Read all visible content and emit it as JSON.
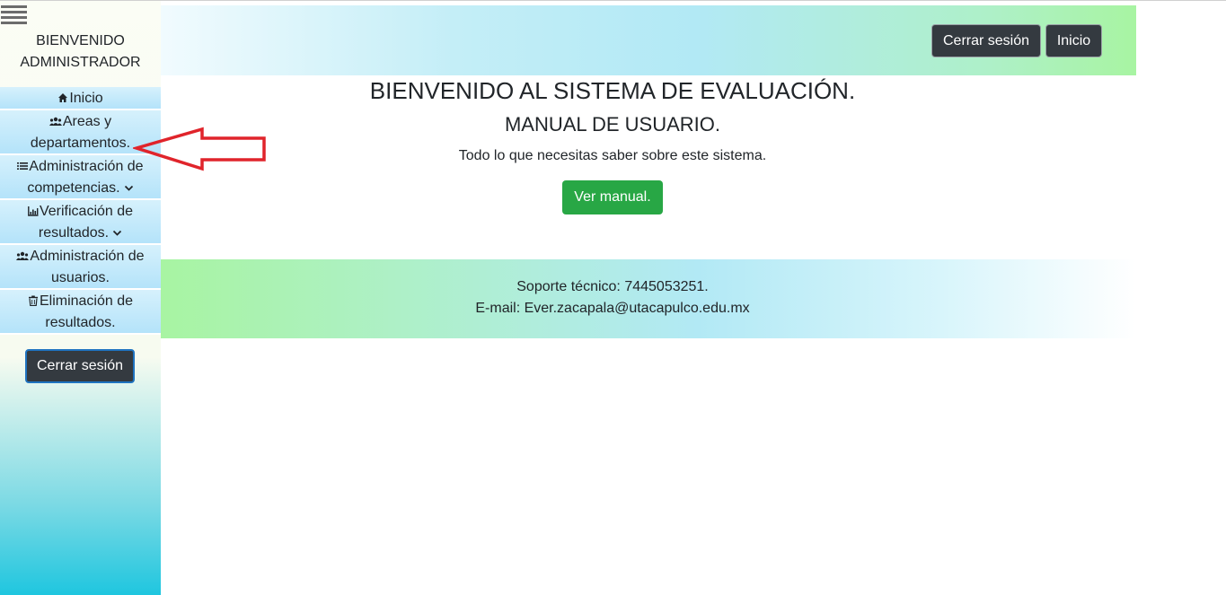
{
  "sidebar": {
    "welcome_line1": "BIENVENIDO",
    "welcome_line2": "ADMINISTRADOR",
    "items": [
      {
        "label": "Inicio",
        "icon": "home-icon"
      },
      {
        "label": "Areas y departamentos.",
        "icon": "users-icon"
      },
      {
        "label": "Administración de competencias.",
        "icon": "list-icon",
        "has_dropdown": true
      },
      {
        "label": "Verificación de resultados.",
        "icon": "chart-icon",
        "has_dropdown": true
      },
      {
        "label": "Administración de usuarios.",
        "icon": "users-icon"
      },
      {
        "label": "Eliminación de resultados.",
        "icon": "trash-icon"
      }
    ],
    "logout_label": "Cerrar sesión"
  },
  "header": {
    "logout_label": "Cerrar sesión",
    "home_label": "Inicio"
  },
  "main": {
    "title": "BIENVENIDO AL SISTEMA DE EVALUACIÓN.",
    "subtitle": "MANUAL DE USUARIO.",
    "description": "Todo lo que necesitas saber sobre este sistema.",
    "manual_button": "Ver manual."
  },
  "footer": {
    "support": "Soporte técnico: 7445053251.",
    "email": "E-mail: Ever.zacapala@utacapulco.edu.mx"
  },
  "colors": {
    "dark_button": "#343a40",
    "success_button": "#28a745",
    "annotation_arrow": "#e0242b"
  }
}
